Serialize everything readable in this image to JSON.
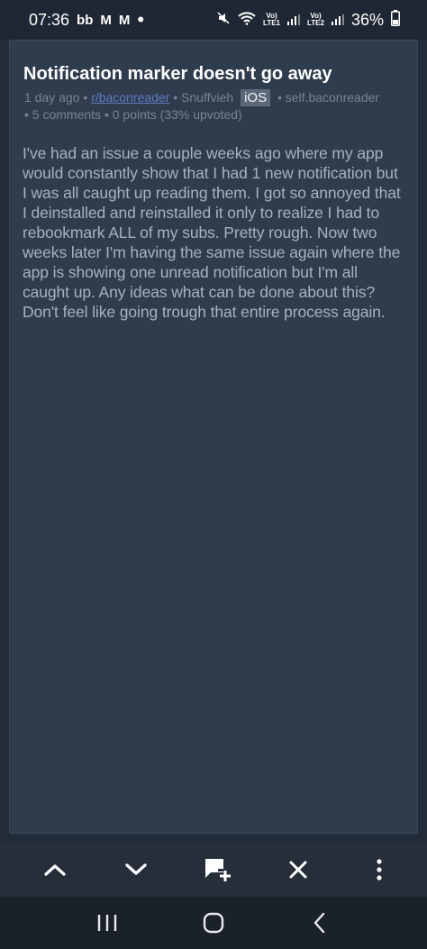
{
  "status_bar": {
    "time": "07:36",
    "notification_glyphs": [
      "bb",
      "M",
      "M"
    ],
    "dot": "•",
    "signal_1_label": [
      "Vo)",
      "LTE1"
    ],
    "signal_2_label": [
      "Vo)",
      "LTE2"
    ],
    "battery": "36%"
  },
  "post": {
    "title": "Notification marker doesn't go away",
    "age": "1 day ago",
    "subreddit": "r/baconreader",
    "author": "Snuffvieh",
    "flair": "iOS",
    "domain": "self.baconreader",
    "comments": "5 comments",
    "points": "0 points (33% upvoted)",
    "body": "I've had an issue a couple weeks ago where my app would constantly show that I had 1 new notification but I was all caught up reading them. I got so annoyed that I deinstalled and reinstalled it only to realize I had to rebookmark ALL of my subs. Pretty rough. Now two weeks later I'm having the same issue again where the app is showing one unread notification but I'm all caught up. Any ideas what can be done about this? Don't feel like going trough that entire process again."
  },
  "toolbar": {
    "icons": [
      "chevron-up-icon",
      "chevron-down-icon",
      "add-comment-icon",
      "close-icon",
      "more-vertical-icon"
    ]
  },
  "nav_bar": {
    "icons": [
      "recent-apps-icon",
      "home-icon",
      "back-icon"
    ]
  },
  "colors": {
    "background": "#222c39",
    "card": "#2f3c4d",
    "link": "#5e7cc2",
    "meta": "#788495"
  }
}
